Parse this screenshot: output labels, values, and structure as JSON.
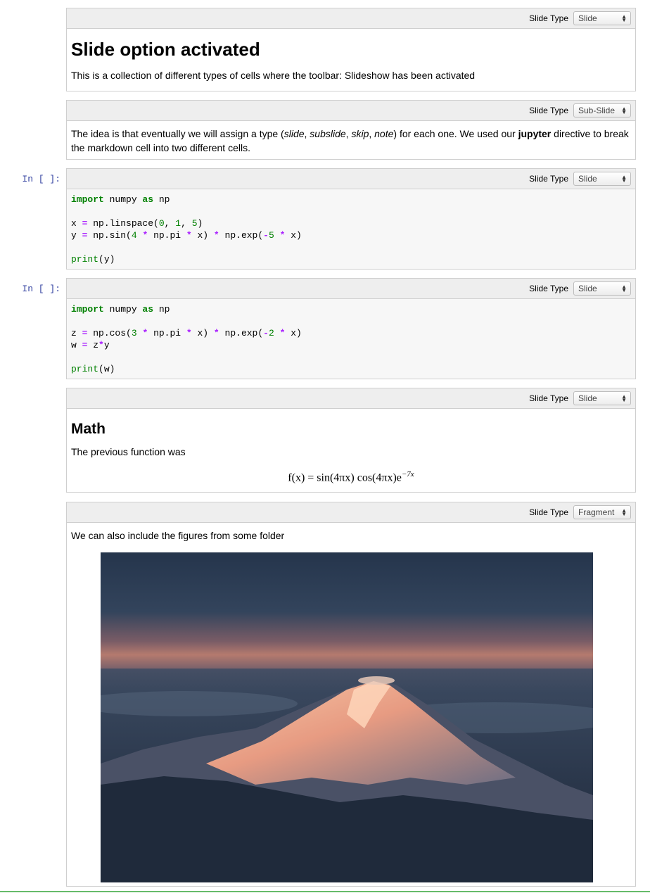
{
  "toolbar_label": "Slide Type",
  "cells": [
    {
      "slide_type": "Slide",
      "heading": "Slide option activated",
      "text": "This is a collection of different types of cells where the toolbar: Slideshow has been activated"
    },
    {
      "slide_type": "Sub-Slide",
      "text_parts": [
        "The idea is that eventually we will assign a type (",
        "slide",
        ", ",
        "subslide",
        ", ",
        "skip",
        ", ",
        "note",
        ") for each one. We used our ",
        "jupyter",
        " directive to break the markdown cell into two different cells."
      ]
    },
    {
      "prompt": "In [ ]:",
      "slide_type": "Slide"
    },
    {
      "prompt": "In [ ]:",
      "slide_type": "Slide"
    },
    {
      "slide_type": "Slide",
      "heading": "Math",
      "text": "The previous function was",
      "formula": {
        "lhs": "f(x) = sin(4πx) cos(4πx)e",
        "exp": "−7x"
      }
    },
    {
      "slide_type": "Fragment",
      "text": "We can also include the figures from some folder",
      "figure": "mountain-photo"
    }
  ],
  "colors": {
    "prompt": "#303f9f",
    "keyword": "#008000",
    "operator": "#aa22ff",
    "bottom_bar": "#66bb6a"
  }
}
